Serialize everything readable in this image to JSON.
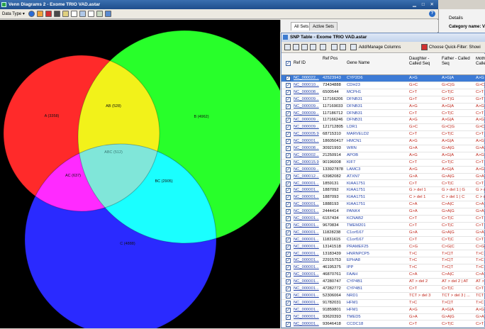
{
  "venn_window": {
    "title": "Venn Diagrams 2 - Exome TRIO VAD.astar",
    "window_controls": "▁ □ ✕",
    "toolbar": {
      "data_type_label": "Data Type ▾"
    },
    "help_glyph": "?",
    "sets": [
      {
        "label": "A (3358)",
        "color": "#ff2a2a"
      },
      {
        "label": "B (4962)",
        "color": "#28ff2a"
      },
      {
        "label": "C (4888)",
        "color": "#2a2aff"
      }
    ],
    "regions": [
      {
        "label": "AB (528)",
        "color": "#f2f21a"
      },
      {
        "label": "AC (637)",
        "color": "#ff2aff"
      },
      {
        "label": "BC (2905)",
        "color": "#1affff"
      },
      {
        "label": "ABC (512)",
        "color": "#80e6d9"
      }
    ]
  },
  "sets_panel": {
    "tabs": [
      "All Sets",
      "Active Sets"
    ]
  },
  "details_panel": {
    "header": "Details",
    "key": "Category name: Vari"
  },
  "snp_window": {
    "title": "SNP Table - Exome TRIO VAD.astar",
    "toolbar": {
      "add_manage_label": "Add/Manage Columns",
      "quick_filter_label": "Choose Quick-Filter: Showi"
    },
    "columns": [
      "Ref ID",
      "Ref Pos",
      "Gene Name",
      "Daughter - Called Seq",
      "Father - Called Seq",
      "Moth Calle"
    ],
    "rows": [
      [
        "NC_000022...",
        "42523943",
        "CYP2D6",
        "A>G",
        "A>G|A",
        "A>G"
      ],
      [
        "NC_000010...",
        "73434888",
        "CDH23",
        "G>C",
        "G>C|G",
        "G>C"
      ],
      [
        "NC_000008...",
        "6500544",
        "MCPH1",
        "C>T",
        "C>T|C",
        "C>T"
      ],
      [
        "NC_000009...",
        "117166206",
        "DFNB31",
        "G>T",
        "G>T|G",
        "G>T"
      ],
      [
        "NC_000009...",
        "117169033",
        "DFNB31",
        "A>G",
        "A>G|A",
        "A>G"
      ],
      [
        "NC_000009...",
        "117186712",
        "DFNB31",
        "C>T",
        "C>T|C",
        "C>T"
      ],
      [
        "NC_000009...",
        "117166246",
        "DFNB31",
        "A>G",
        "A>G|A",
        "A>G"
      ],
      [
        "NC_000009...",
        "121712805",
        "LDR1",
        "G>C",
        "G>C|G",
        "G>C"
      ],
      [
        "NC_000005.9",
        "68715310",
        "MARVELD2",
        "C>T",
        "C>T|C",
        "C>T"
      ],
      [
        "NC_000001...",
        "186050417",
        "HMCN1",
        "A>G",
        "A>G|A",
        "A>G"
      ],
      [
        "NC_000008...",
        "30921993",
        "WRN",
        "G>A",
        "G>A|G",
        "G>A"
      ],
      [
        "NC_000002...",
        "21250914",
        "APOB",
        "A>G",
        "A>G|A",
        "A>G"
      ],
      [
        "NC_000015.9",
        "90196008",
        "KIF7",
        "C>T",
        "C>T|C",
        "C>T"
      ],
      [
        "NC_000009...",
        "133927878",
        "LAMC3",
        "A>G",
        "A>G|A",
        "A>G"
      ],
      [
        "NC_000012...",
        "63982082",
        "ATXN7",
        "G>A",
        "G>A|G",
        "G>A"
      ],
      [
        "NC_000001...",
        "1859131",
        "KIAA1751",
        "C>T",
        "C>T|C",
        "C>T"
      ],
      [
        "NC_000001...",
        "1887092",
        "KIAA1751",
        "G > del 1",
        "G > del 1 | G",
        "G > d"
      ],
      [
        "NC_000001...",
        "1887093",
        "KIAA1751",
        "C > del 1",
        "C > del 1 | C",
        "C > d"
      ],
      [
        "NC_000001...",
        "1888193",
        "KIAA1751",
        "C>A",
        "C>A|C",
        "C>A"
      ],
      [
        "NC_000001...",
        "2444414",
        "PANK4",
        "G>A",
        "G>A|G",
        "G>A"
      ],
      [
        "NC_000001...",
        "6157434",
        "KCNAB2",
        "C>T",
        "C>T|C",
        "C>T"
      ],
      [
        "NC_000001...",
        "9670834",
        "TMEM201",
        "C>T",
        "C>T|C",
        "C>T"
      ],
      [
        "NC_000001...",
        "11828238",
        "C1orf167",
        "G>A",
        "G>A|G",
        "G>A"
      ],
      [
        "NC_000001...",
        "11831615",
        "C1orf167",
        "C>T",
        "C>T|C",
        "C>T"
      ],
      [
        "NC_000001...",
        "13141518",
        "PRAMEF25",
        "C>G",
        "C>G|C",
        "C>G"
      ],
      [
        "NC_000001...",
        "13183439",
        "HNRNPCP5",
        "T>C",
        "T>C|T",
        "T>C"
      ],
      [
        "NC_000001...",
        "22915753",
        "EPHA8",
        "T>C",
        "T>C|T",
        "T>C"
      ],
      [
        "NC_000001...",
        "46195375",
        "IPP",
        "T>C",
        "T>C|T",
        "T>C"
      ],
      [
        "NC_000001...",
        "46870761",
        "FAAH",
        "C>A",
        "C>A|C",
        "C>A"
      ],
      [
        "NC_000001...",
        "47280747",
        "CYP4B1",
        "AT > del 2",
        "AT > del 2 | AT",
        "AT >"
      ],
      [
        "NC_000001...",
        "47282772",
        "CYP4B1",
        "C>T",
        "C>T|C",
        "C>T"
      ],
      [
        "NC_000001...",
        "52306064",
        "NRD1",
        "TCT > del 3",
        "TCT > del 3 | ...",
        "TCT >"
      ],
      [
        "NC_000001...",
        "91782031",
        "HFM1",
        "T>C",
        "T>C|T",
        "T>C"
      ],
      [
        "NC_000001...",
        "91859801",
        "HFM1",
        "A>G",
        "A>G|A",
        "A>G"
      ],
      [
        "NC_000001...",
        "93620393",
        "TMED5",
        "G>A",
        "G>A|G",
        "G>A"
      ],
      [
        "NC_000001...",
        "93646418",
        "CCDC18",
        "C>T",
        "C>T|C",
        "C>T"
      ]
    ]
  }
}
